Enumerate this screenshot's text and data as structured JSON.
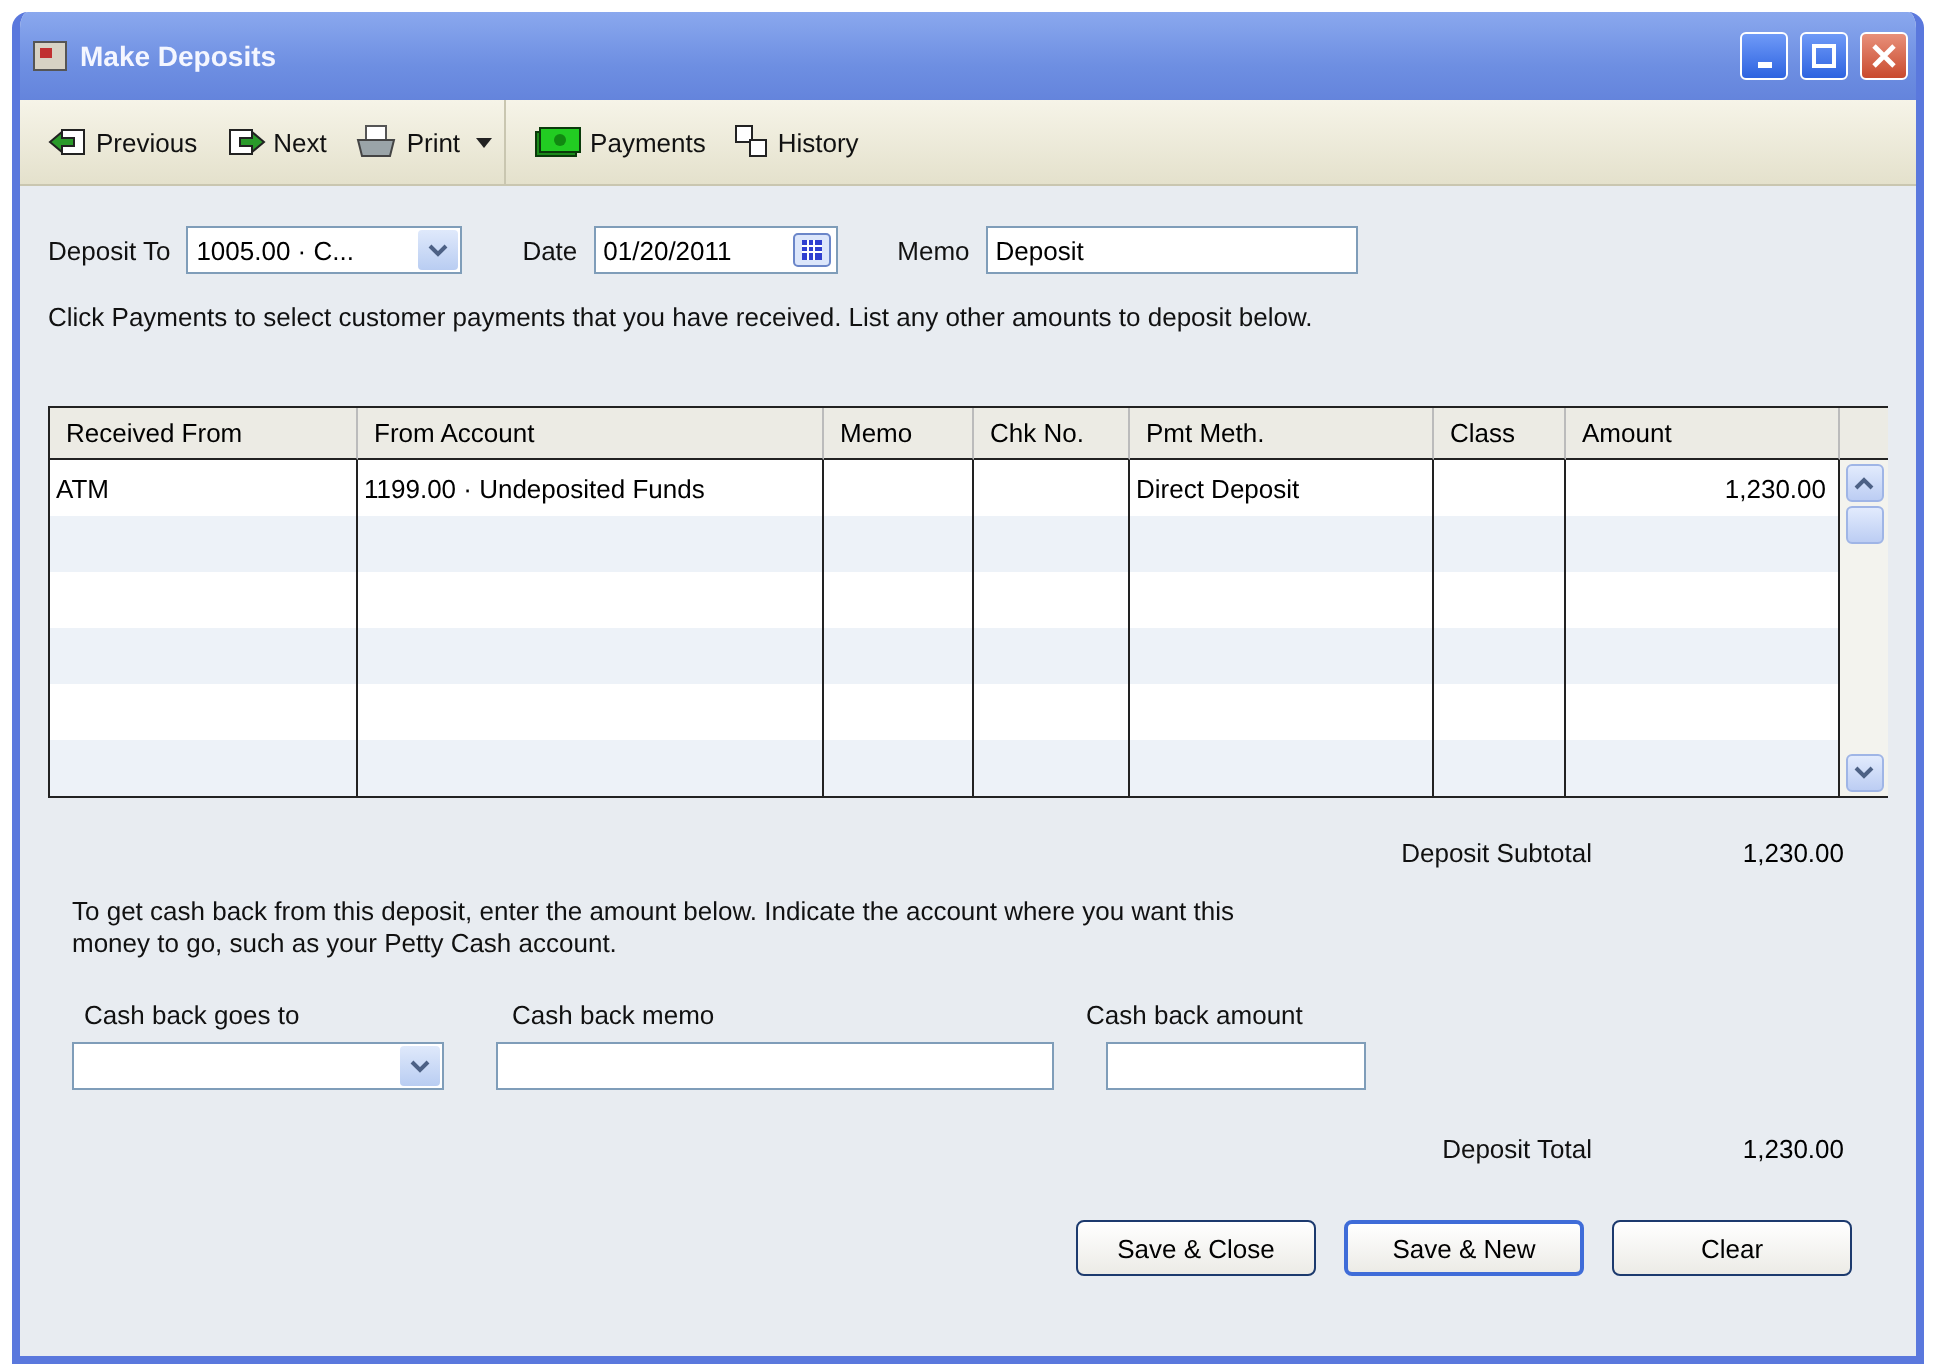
{
  "window": {
    "title": "Make Deposits"
  },
  "toolbar": {
    "groups": [
      [
        {
          "label": "Previous",
          "kind": "button"
        },
        {
          "label": "Next",
          "kind": "button"
        },
        {
          "label": "Print",
          "kind": "split"
        }
      ],
      [
        {
          "label": "Payments",
          "kind": "button"
        },
        {
          "label": "History",
          "kind": "button"
        }
      ]
    ]
  },
  "header": {
    "deposit_to": {
      "label": "Deposit To",
      "value": "1005.00 · C..."
    },
    "date": {
      "label": "Date",
      "value": "01/20/2011"
    },
    "memo": {
      "label": "Memo",
      "value": "Deposit"
    }
  },
  "instructions": "Click Payments to select customer payments that you have received. List any other amounts to deposit below.",
  "table": {
    "columns": [
      "Received From",
      "From Account",
      "Memo",
      "Chk No.",
      "Pmt Meth.",
      "Class",
      "Amount"
    ],
    "rows": [
      [
        "ATM",
        "1199.00 · Undeposited Funds",
        "",
        "",
        "Direct Deposit",
        "",
        "1,230.00"
      ]
    ]
  },
  "subtotal": {
    "label": "Deposit Subtotal",
    "value": "1,230.00"
  },
  "cash_back": {
    "note": "To get cash back from this deposit, enter the amount below.  Indicate the account where you want this money to go, such as your Petty Cash account.",
    "goes_to_label": "Cash back goes to",
    "memo_label": "Cash back memo",
    "amount_label": "Cash back amount"
  },
  "total": {
    "label": "Deposit Total",
    "value": "1,230.00"
  },
  "buttons": [
    {
      "label": "Save & Close",
      "default": false
    },
    {
      "label": "Save & New",
      "default": true
    },
    {
      "label": "Clear",
      "default": false
    }
  ]
}
